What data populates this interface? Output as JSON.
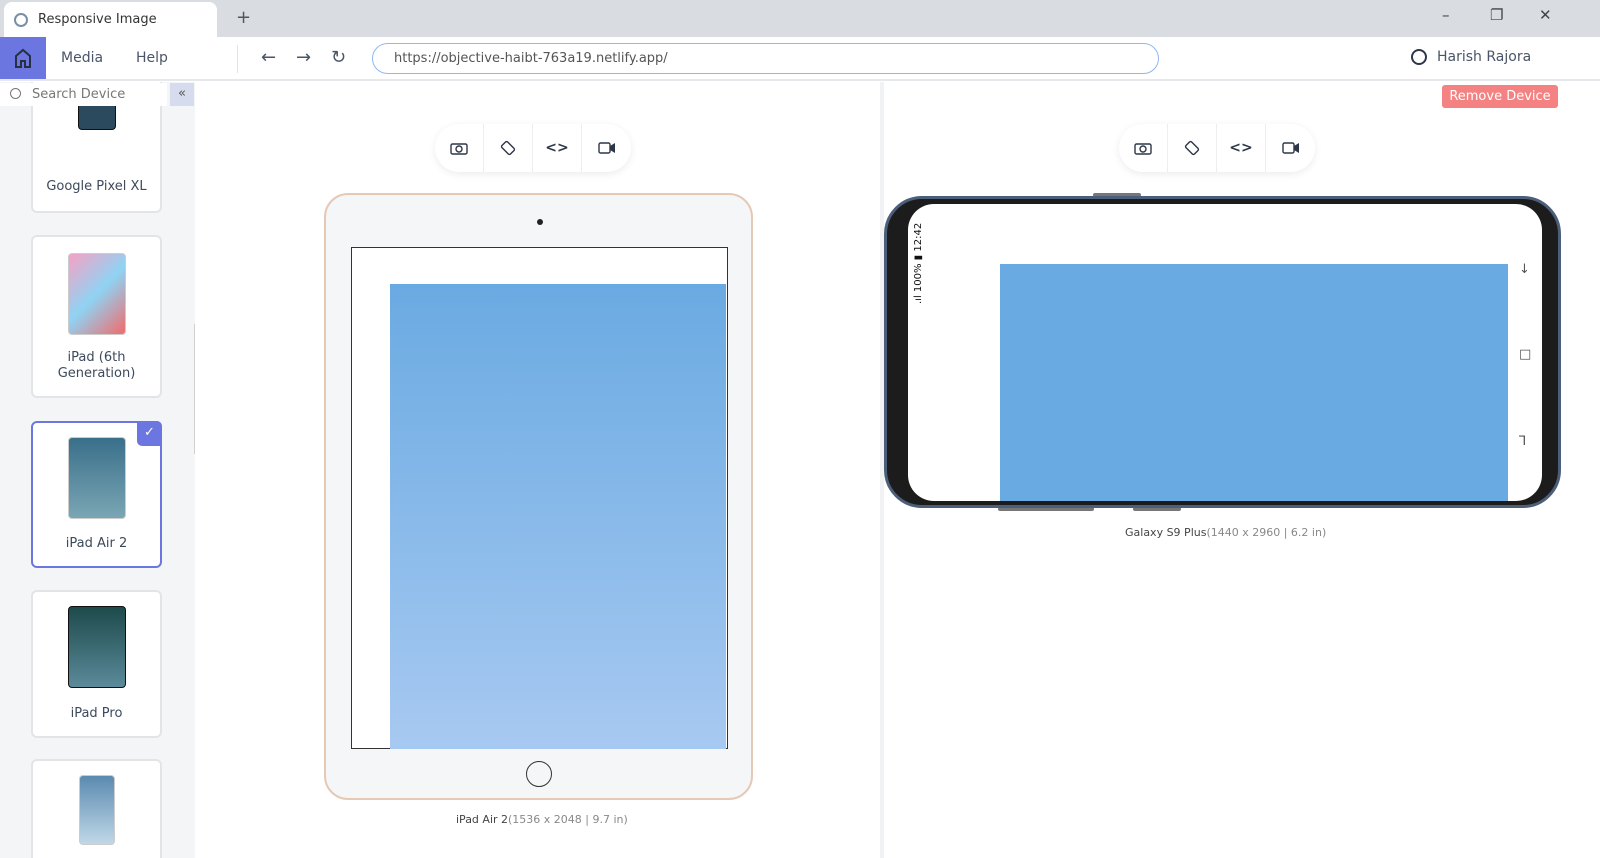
{
  "browser": {
    "tab_title": "Responsive Image",
    "new_tab": "+",
    "minimize": "–",
    "maximize": "❐",
    "close": "✕"
  },
  "toolbar": {
    "menu": [
      "Media",
      "Help"
    ],
    "back": "←",
    "forward": "→",
    "reload": "↻",
    "url": "https://objective-haibt-763a19.netlify.app/",
    "user": "Harish Rajora"
  },
  "sidebar": {
    "search_placeholder": "Search Device",
    "collapse": "«",
    "devices": [
      {
        "name": "Google Pixel XL",
        "selected": false
      },
      {
        "name": "iPad (6th Generation)",
        "selected": false
      },
      {
        "name": "iPad Air 2",
        "selected": true
      },
      {
        "name": "iPad Pro",
        "selected": false
      },
      {
        "name": "",
        "selected": false
      }
    ],
    "check": "✓"
  },
  "toolbar_icons": {
    "camera": "📷",
    "rotate": "⟲",
    "code": "<>",
    "video": "▶"
  },
  "devices": [
    {
      "name": "iPad Air 2",
      "spec": "(1536 x 2048 | 9.7 in)"
    },
    {
      "name": "Galaxy S9 Plus",
      "spec": "(1440 x 2960 | 6.2 in)",
      "status": ".ıl 100% ▮ 12:42",
      "nav_back": "↓",
      "nav_home": "□",
      "nav_recent": "⅂"
    }
  ],
  "remove_device": "Remove Device",
  "colors": {
    "accent": "#6b76e0",
    "remove": "#f48282",
    "image": "#6aaae2"
  }
}
